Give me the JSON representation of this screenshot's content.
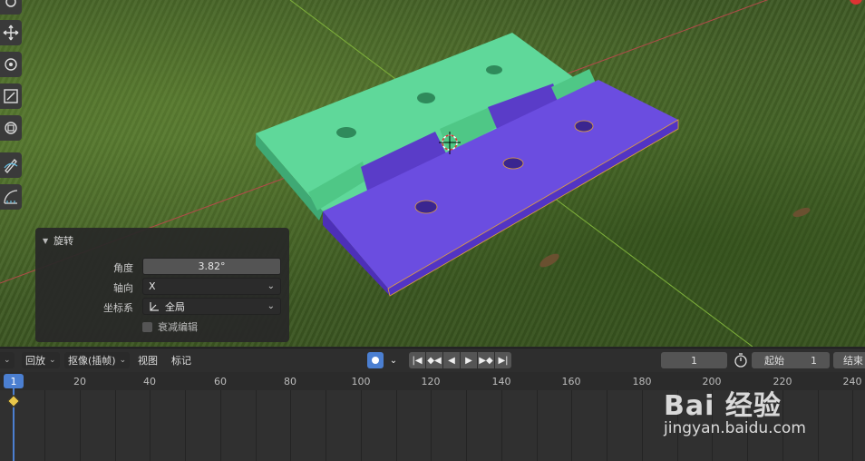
{
  "toolbar": {
    "tools": [
      "move-icon",
      "rotate-icon",
      "scale-icon",
      "transform-icon",
      "annotate-icon",
      "measure-icon"
    ]
  },
  "operator_panel": {
    "title": "旋转",
    "angle_label": "角度",
    "angle_value": "3.82°",
    "axis_label": "轴向",
    "axis_value": "X",
    "orient_label": "坐标系",
    "orient_value": "全局",
    "falloff_label": "衰减编辑",
    "falloff_checked": false
  },
  "timeline": {
    "playback_label": "回放",
    "keying_label": "抠像(插帧)",
    "view_label": "视图",
    "marker_label": "标记",
    "current_frame": "1",
    "start_label": "起始",
    "start_value": "1",
    "end_label": "结束",
    "ruler_current": "1",
    "ruler_ticks": [
      "20",
      "40",
      "60",
      "80",
      "100",
      "120",
      "140",
      "160",
      "180",
      "200",
      "220",
      "240"
    ]
  },
  "watermark": {
    "logo": "Bai 经验",
    "url": "jingyan.baidu.com"
  },
  "colors": {
    "green_leaf": "#5fd89a",
    "purple_leaf": "#6b4de0",
    "accent_blue": "#4b7fd1"
  }
}
